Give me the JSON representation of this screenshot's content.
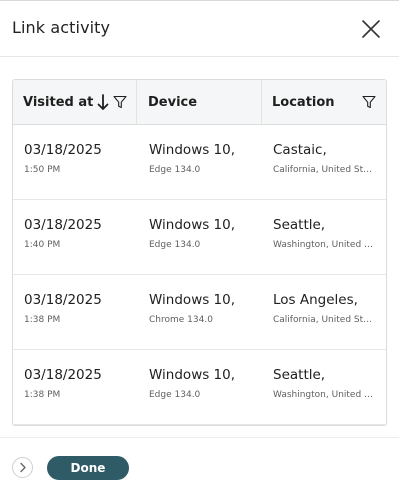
{
  "header": {
    "title": "Link activity"
  },
  "icons": {
    "close": "close-icon",
    "sort": "arrow-down-icon",
    "filter": "filter-icon",
    "chevron": "chevron-right-icon"
  },
  "table": {
    "columns": [
      "Visited at",
      "Device",
      "Location"
    ],
    "rows": [
      {
        "date": "03/18/2025",
        "time": "1:50 PM",
        "device": "Windows 10,",
        "browser": "Edge 134.0",
        "city": "Castaic,",
        "region": "California, United States"
      },
      {
        "date": "03/18/2025",
        "time": "1:40 PM",
        "device": "Windows 10,",
        "browser": "Edge 134.0",
        "city": "Seattle,",
        "region": "Washington, United States"
      },
      {
        "date": "03/18/2025",
        "time": "1:38 PM",
        "device": "Windows 10,",
        "browser": "Chrome 134.0",
        "city": "Los Angeles,",
        "region": "California, United States"
      },
      {
        "date": "03/18/2025",
        "time": "1:38 PM",
        "device": "Windows 10,",
        "browser": "Edge 134.0",
        "city": "Seattle,",
        "region": "Washington, United States"
      }
    ]
  },
  "footer": {
    "done_label": "Done"
  },
  "colors": {
    "accent": "#2f5b66",
    "header_bg": "#f5f6f7",
    "border": "#dcdcdc"
  }
}
